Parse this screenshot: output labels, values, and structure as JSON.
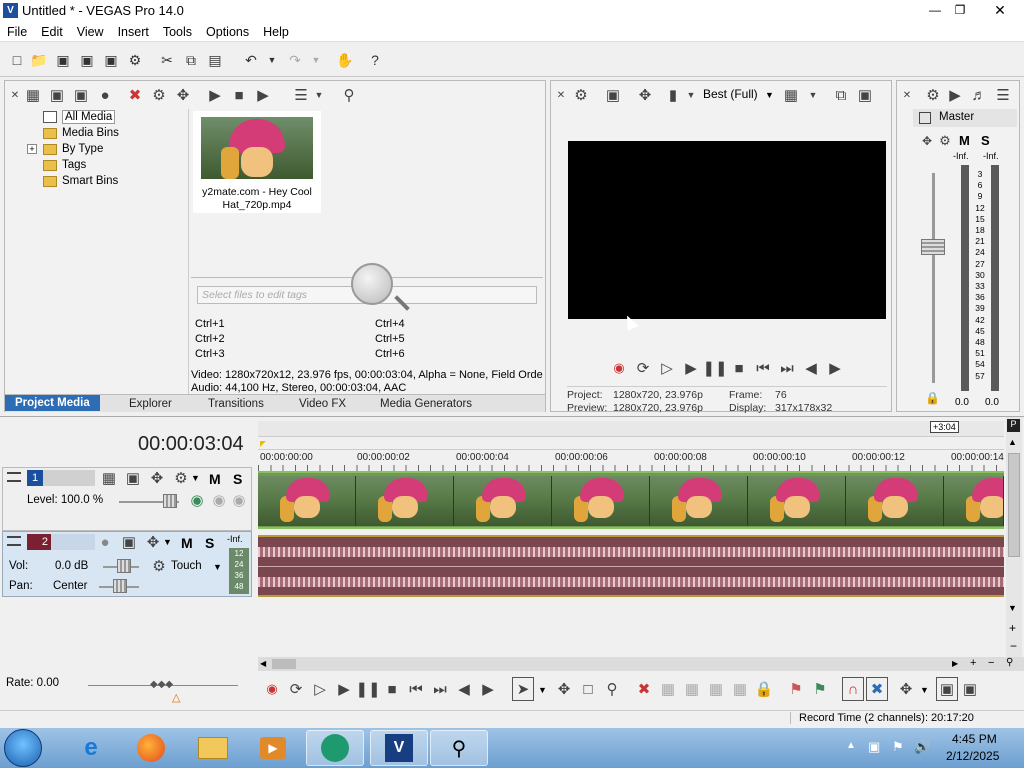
{
  "window": {
    "title": "Untitled * - VEGAS Pro 14.0"
  },
  "menu": [
    "File",
    "Edit",
    "View",
    "Insert",
    "Tools",
    "Options",
    "Help"
  ],
  "media_tree": {
    "items": [
      {
        "label": "All Media",
        "selected": true
      },
      {
        "label": "Media Bins"
      },
      {
        "label": "By Type",
        "expandable": true
      },
      {
        "label": "Tags"
      },
      {
        "label": "Smart Bins"
      }
    ]
  },
  "media_file": {
    "name": "y2mate.com - Hey Cool Hat_720p.mp4"
  },
  "tags": {
    "placeholder": "Select files to edit tags",
    "shortcuts": [
      "Ctrl+1",
      "Ctrl+4",
      "Ctrl+2",
      "Ctrl+5",
      "Ctrl+3",
      "Ctrl+6"
    ]
  },
  "media_info": {
    "video": "Video: 1280x720x12, 23.976 fps, 00:00:03:04, Alpha = None, Field Orde",
    "audio": "Audio: 44,100 Hz, Stereo, 00:00:03:04, AAC"
  },
  "left_tabs": [
    "Project Media",
    "Explorer",
    "Transitions",
    "Video FX",
    "Media Generators"
  ],
  "preview": {
    "quality": "Best (Full)",
    "project_label": "Project:",
    "project_val": "1280x720, 23.976p",
    "preview_label": "Preview:",
    "preview_val": "1280x720, 23.976p",
    "frame_label": "Frame:",
    "frame_val": "76",
    "display_label": "Display:",
    "display_val": "317x178x32"
  },
  "master": {
    "label": "Master",
    "inf_l": "-Inf.",
    "inf_r": "-Inf.",
    "scale": [
      "3",
      "6",
      "9",
      "12",
      "15",
      "18",
      "21",
      "24",
      "27",
      "30",
      "33",
      "36",
      "39",
      "42",
      "45",
      "48",
      "51",
      "54",
      "57"
    ],
    "val_l": "0.0",
    "val_r": "0.0"
  },
  "timeline": {
    "timecode": "00:00:03:04",
    "marker": "+3:04",
    "ruler": [
      "00:00:00:00",
      "00:00:00:02",
      "00:00:00:04",
      "00:00:00:06",
      "00:00:00:08",
      "00:00:00:10",
      "00:00:00:12",
      "00:00:00:14"
    ]
  },
  "video_track": {
    "num": "1",
    "level": "Level: 100.0 %"
  },
  "audio_track": {
    "num": "2",
    "inf": "-Inf.",
    "vol_label": "Vol:",
    "vol_val": "0.0 dB",
    "pan_label": "Pan:",
    "pan_val": "Center",
    "mode": "Touch",
    "meter_scale": [
      "12",
      "24",
      "36",
      "48"
    ]
  },
  "rate": "Rate: 0.00",
  "status": "Record Time (2 channels): 20:17:20",
  "clock": {
    "time": "4:45 PM",
    "date": "2/12/2025"
  },
  "colors": {
    "accent": "#2d6db5",
    "video_clip": "#6e9b4e",
    "audio_clip": "#7a4750"
  }
}
